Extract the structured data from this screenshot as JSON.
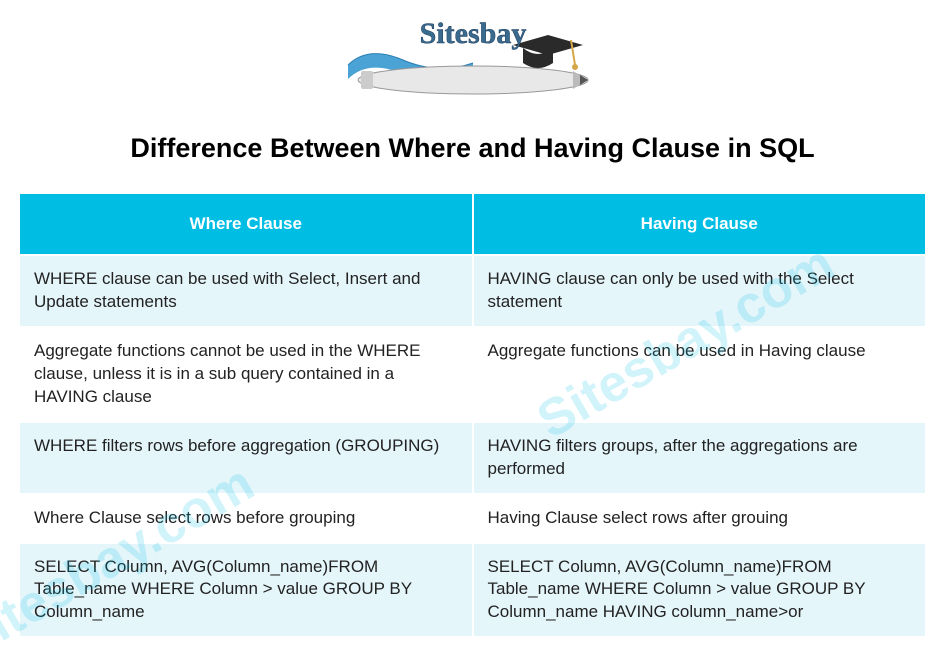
{
  "logo": {
    "text": "Sitesbay"
  },
  "title": "Difference Between Where and Having Clause in SQL",
  "watermark": "Sitesbay.com",
  "table": {
    "headers": [
      "Where Clause",
      "Having Clause"
    ],
    "rows": [
      [
        "WHERE clause can be used with Select, Insert and Update statements",
        "HAVING clause can only be used with the Select statement"
      ],
      [
        "Aggregate functions cannot be used in the WHERE clause, unless it is in a sub query contained in a HAVING clause",
        "Aggregate functions can be used in Having clause"
      ],
      [
        "WHERE filters rows before aggregation (GROUPING)",
        "HAVING filters groups, after the aggregations are performed"
      ],
      [
        "Where Clause select rows before grouping",
        "Having Clause select rows after grouing"
      ],
      [
        "SELECT Column, AVG(Column_name)FROM Table_name WHERE Column > value GROUP BY Column_name",
        "SELECT Column, AVG(Column_name)FROM Table_name WHERE Column > value GROUP BY Column_name HAVING column_name>or"
      ]
    ]
  }
}
